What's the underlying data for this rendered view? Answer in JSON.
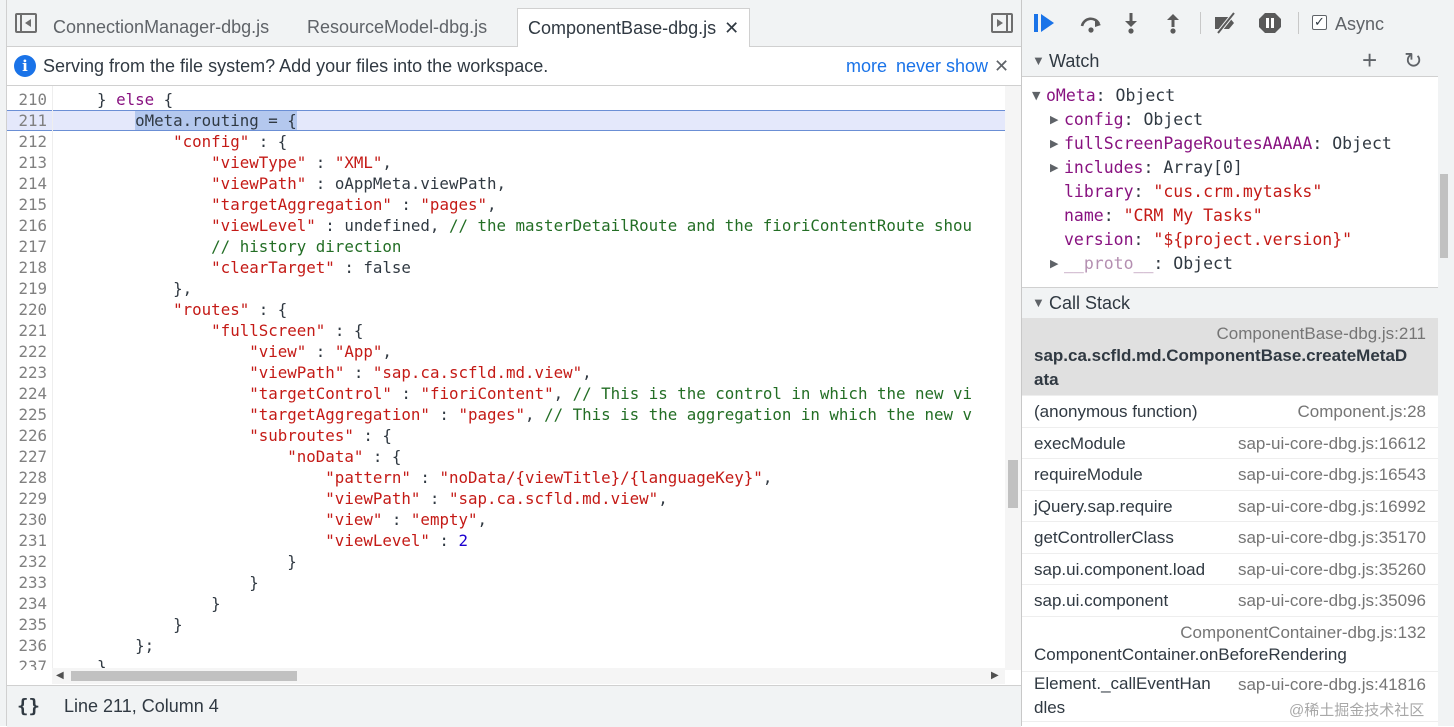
{
  "tabs": [
    {
      "label": "ConnectionManager-dbg.js",
      "active": false
    },
    {
      "label": "ResourceModel-dbg.js",
      "active": false
    },
    {
      "label": "ComponentBase-dbg.js",
      "active": true
    }
  ],
  "tab_close_glyph": "✕",
  "infobar": {
    "text": "Serving from the file system? Add your files into the workspace.",
    "more": "more",
    "never_show": "never show",
    "close": "✕",
    "icon": "info-icon"
  },
  "code_lines": [
    {
      "n": "210",
      "html": "    } <span class=\"kw\">else</span> {"
    },
    {
      "n": "211",
      "html": "        <span class=\"sel\">oMeta.routing = {</span>",
      "highlight": true
    },
    {
      "n": "212",
      "html": "            <span class=\"str\">\"config\"</span> : {"
    },
    {
      "n": "213",
      "html": "                <span class=\"str\">\"viewType\"</span> : <span class=\"str\">\"XML\"</span>,"
    },
    {
      "n": "214",
      "html": "                <span class=\"str\">\"viewPath\"</span> : oAppMeta.viewPath,"
    },
    {
      "n": "215",
      "html": "                <span class=\"str\">\"targetAggregation\"</span> : <span class=\"str\">\"pages\"</span>,"
    },
    {
      "n": "216",
      "html": "                <span class=\"str\">\"viewLevel\"</span> : undefined, <span class=\"cmt\">// the masterDetailRoute and the fioriContentRoute shou</span>"
    },
    {
      "n": "217",
      "html": "                <span class=\"cmt\">// history direction</span>"
    },
    {
      "n": "218",
      "html": "                <span class=\"str\">\"clearTarget\"</span> : false"
    },
    {
      "n": "219",
      "html": "            },"
    },
    {
      "n": "220",
      "html": "            <span class=\"str\">\"routes\"</span> : {"
    },
    {
      "n": "221",
      "html": "                <span class=\"str\">\"fullScreen\"</span> : {"
    },
    {
      "n": "222",
      "html": "                    <span class=\"str\">\"view\"</span> : <span class=\"str\">\"App\"</span>,"
    },
    {
      "n": "223",
      "html": "                    <span class=\"str\">\"viewPath\"</span> : <span class=\"str\">\"sap.ca.scfld.md.view\"</span>,"
    },
    {
      "n": "224",
      "html": "                    <span class=\"str\">\"targetControl\"</span> : <span class=\"str\">\"fioriContent\"</span>, <span class=\"cmt\">// This is the control in which the new vi</span>"
    },
    {
      "n": "225",
      "html": "                    <span class=\"str\">\"targetAggregation\"</span> : <span class=\"str\">\"pages\"</span>, <span class=\"cmt\">// This is the aggregation in which the new v</span>"
    },
    {
      "n": "226",
      "html": "                    <span class=\"str\">\"subroutes\"</span> : {"
    },
    {
      "n": "227",
      "html": "                        <span class=\"str\">\"noData\"</span> : {"
    },
    {
      "n": "228",
      "html": "                            <span class=\"str\">\"pattern\"</span> : <span class=\"str\">\"noData/{viewTitle}/{languageKey}\"</span>,"
    },
    {
      "n": "229",
      "html": "                            <span class=\"str\">\"viewPath\"</span> : <span class=\"str\">\"sap.ca.scfld.md.view\"</span>,"
    },
    {
      "n": "230",
      "html": "                            <span class=\"str\">\"view\"</span> : <span class=\"str\">\"empty\"</span>,"
    },
    {
      "n": "231",
      "html": "                            <span class=\"str\">\"viewLevel\"</span> : <span class=\"num\">2</span>"
    },
    {
      "n": "232",
      "html": "                        }"
    },
    {
      "n": "233",
      "html": "                    }"
    },
    {
      "n": "234",
      "html": "                }"
    },
    {
      "n": "235",
      "html": "            }"
    },
    {
      "n": "236",
      "html": "        };"
    },
    {
      "n": "237",
      "html": "    }"
    }
  ],
  "statusbar": {
    "pretty_print": "{}",
    "position": "Line 211, Column 4"
  },
  "toolbar": {
    "icons": [
      "resume-icon",
      "step-over-icon",
      "step-into-icon",
      "step-out-icon",
      "deactivate-breakpoints-icon",
      "pause-on-exceptions-icon"
    ],
    "async_label": "Async",
    "async_checked": true
  },
  "watch": {
    "title": "Watch",
    "add": "+",
    "refresh": "↻",
    "rows": [
      {
        "indent": 0,
        "toggle": "▼",
        "name": "oMeta",
        "sep": ": ",
        "value": "Object",
        "type": "obj"
      },
      {
        "indent": 1,
        "toggle": "▶",
        "name": "config",
        "sep": ": ",
        "value": "Object",
        "type": "obj"
      },
      {
        "indent": 1,
        "toggle": "▶",
        "name": "fullScreenPageRoutesAAAAA",
        "sep": ": ",
        "value": "Object",
        "type": "obj"
      },
      {
        "indent": 1,
        "toggle": "▶",
        "name": "includes",
        "sep": ": ",
        "value": "Array[0]",
        "type": "obj"
      },
      {
        "indent": 1,
        "toggle": "",
        "name": "library",
        "sep": ": ",
        "value": "\"cus.crm.mytasks\"",
        "type": "str"
      },
      {
        "indent": 1,
        "toggle": "",
        "name": "name",
        "sep": ": ",
        "value": "\"CRM My Tasks\"",
        "type": "str"
      },
      {
        "indent": 1,
        "toggle": "",
        "name": "version",
        "sep": ": ",
        "value": "\"${project.version}\"",
        "type": "str"
      },
      {
        "indent": 1,
        "toggle": "▶",
        "name": "__proto__",
        "sep": ": ",
        "value": "Object",
        "type": "obj",
        "dim": true
      }
    ]
  },
  "callstack": {
    "title": "Call Stack",
    "frames": [
      {
        "name_lines": [
          "sap.ca.scfld.md.ComponentBase.createMetaD",
          "ata"
        ],
        "location": "ComponentBase-dbg.js:211",
        "selected": true,
        "layout": "loc-top"
      },
      {
        "name_lines": [
          "(anonymous function)"
        ],
        "location": "Component.js:28",
        "layout": "inline"
      },
      {
        "name_lines": [
          "execModule"
        ],
        "location": "sap-ui-core-dbg.js:16612",
        "layout": "inline"
      },
      {
        "name_lines": [
          "requireModule"
        ],
        "location": "sap-ui-core-dbg.js:16543",
        "layout": "inline"
      },
      {
        "name_lines": [
          "jQuery.sap.require"
        ],
        "location": "sap-ui-core-dbg.js:16992",
        "layout": "inline"
      },
      {
        "name_lines": [
          "getControllerClass"
        ],
        "location": "sap-ui-core-dbg.js:35170",
        "layout": "inline"
      },
      {
        "name_lines": [
          "sap.ui.component.load"
        ],
        "location": "sap-ui-core-dbg.js:35260",
        "layout": "inline"
      },
      {
        "name_lines": [
          "sap.ui.component"
        ],
        "location": "sap-ui-core-dbg.js:35096",
        "layout": "inline"
      },
      {
        "name_lines": [
          "ComponentContainer.onBeforeRendering"
        ],
        "location": "ComponentContainer-dbg.js:132",
        "layout": "loc-top"
      },
      {
        "name_lines": [
          "Element._callEventHan",
          "dles"
        ],
        "location": "sap-ui-core-dbg.js:41816",
        "layout": "inline-wrap"
      }
    ]
  },
  "watermark": "@稀土掘金技术社区"
}
